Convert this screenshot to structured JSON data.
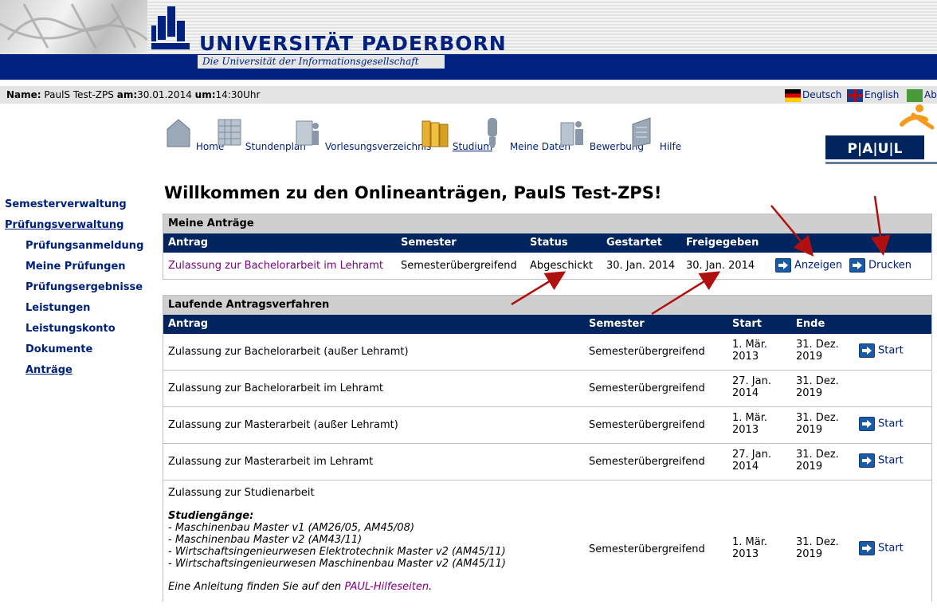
{
  "university": {
    "name": "UNIVERSITÄT PADERBORN",
    "subtitle": "Die Universität der Informationsgesellschaft"
  },
  "infobar": {
    "name_label": "Name:",
    "name_value": "PaulS Test-ZPS",
    "date_label": "am:",
    "date_value": "30.01.2014",
    "time_label": "um:",
    "time_value": "14:30Uhr",
    "lang_de": "Deutsch",
    "lang_en": "English",
    "lang_ab": "Ab"
  },
  "topnav": [
    {
      "label": "Home",
      "icon": "home-icon"
    },
    {
      "label": "Stundenplan",
      "icon": "timetable-icon"
    },
    {
      "label": "Vorlesungsverzeichnis",
      "icon": "lecture-catalog-icon"
    },
    {
      "label": "Studium",
      "icon": "folders-icon"
    },
    {
      "label": "Meine Daten",
      "icon": "person-icon"
    },
    {
      "label": "Bewerbung",
      "icon": "application-icon"
    },
    {
      "label": "Hilfe",
      "icon": "help-icon"
    }
  ],
  "paul_logo": "P|A|U|L",
  "leftnav": {
    "semesterverwaltung": "Semesterverwaltung",
    "pruefungsverwaltung": "Prüfungsverwaltung",
    "sub": [
      "Prüfungsanmeldung",
      "Meine Prüfungen",
      "Prüfungsergebnisse",
      "Leistungen",
      "Leistungskonto",
      "Dokumente",
      "Anträge"
    ]
  },
  "page_title": "Willkommen zu den Onlineanträgen, PaulS Test-ZPS!",
  "meine_antraege": {
    "title": "Meine Anträge",
    "headers": {
      "antrag": "Antrag",
      "semester": "Semester",
      "status": "Status",
      "gestartet": "Gestartet",
      "freigegeben": "Freigegeben"
    },
    "row": {
      "antrag": "Zulassung zur Bachelorarbeit im Lehramt",
      "semester": "Semesterübergreifend",
      "status": "Abgeschickt",
      "gestartet": "30. Jan. 2014",
      "freigegeben": "30. Jan. 2014",
      "anzeigen": "Anzeigen",
      "drucken": "Drucken"
    }
  },
  "laufende": {
    "title": "Laufende Antragsverfahren",
    "headers": {
      "antrag": "Antrag",
      "semester": "Semester",
      "start": "Start",
      "ende": "Ende"
    },
    "rows": [
      {
        "antrag": "Zulassung zur Bachelorarbeit (außer Lehramt)",
        "semester": "Semesterübergreifend",
        "start1": "1. Mär.",
        "start2": "2013",
        "end1": "31. Dez.",
        "end2": "2019",
        "action": "Start"
      },
      {
        "antrag": "Zulassung zur Bachelorarbeit im Lehramt",
        "semester": "Semesterübergreifend",
        "start1": "27. Jan.",
        "start2": "2014",
        "end1": "31. Dez.",
        "end2": "2019",
        "action": ""
      },
      {
        "antrag": "Zulassung zur Masterarbeit (außer Lehramt)",
        "semester": "Semesterübergreifend",
        "start1": "1. Mär.",
        "start2": "2013",
        "end1": "31. Dez.",
        "end2": "2019",
        "action": "Start"
      },
      {
        "antrag": "Zulassung zur Masterarbeit im Lehramt",
        "semester": "Semesterübergreifend",
        "start1": "27. Jan.",
        "start2": "2014",
        "end1": "31. Dez.",
        "end2": "2019",
        "action": "Start"
      }
    ],
    "studienarbeit": {
      "antrag": "Zulassung zur Studienarbeit",
      "studiengaenge_label": "Studiengänge:",
      "studiengaenge": [
        "- Maschinenbau Master v1 (AM26/05, AM45/08)",
        "- Maschinenbau Master v2 (AM43/11)",
        "- Wirtschaftsingenieurwesen Elektrotechnik Master v2 (AM45/11)",
        "- Wirtschaftsingenieurwesen Maschinenbau Master v2 (AM45/11)"
      ],
      "anleitung_prefix": "Eine Anleitung finden Sie auf den ",
      "anleitung_link": "PAUL-Hilfeseiten",
      "anleitung_suffix": ".",
      "semester": "Semesterübergreifend",
      "start1": "1. Mär.",
      "start2": "2013",
      "end1": "31. Dez.",
      "end2": "2019",
      "action": "Start"
    }
  },
  "colors": {
    "brand": "#00217e",
    "header_row": "#00245e",
    "link_purple": "#800080",
    "annotation_arrow": "#b01010"
  }
}
